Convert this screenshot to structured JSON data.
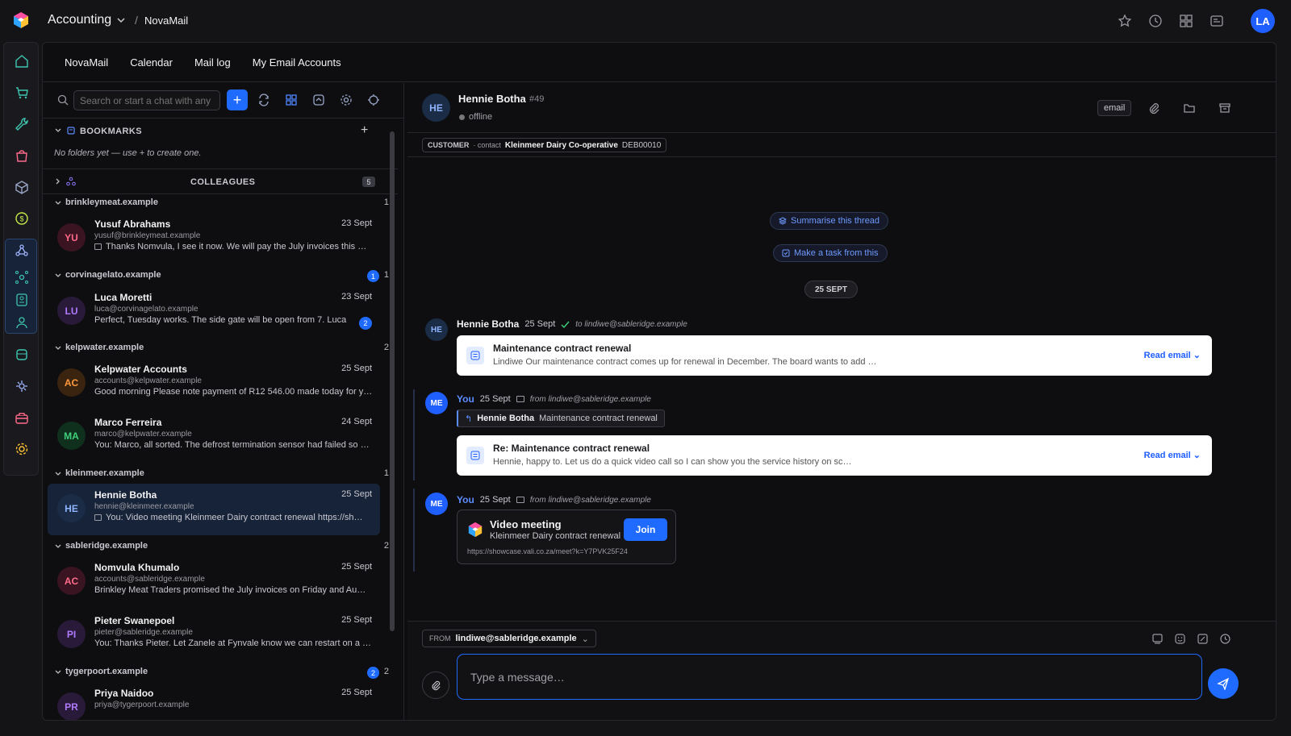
{
  "app": {
    "module": "Accounting",
    "breadcrumb": "NovaMail",
    "user_initials": "LA"
  },
  "tabs": [
    "NovaMail",
    "Calendar",
    "Mail log",
    "My Email Accounts"
  ],
  "search": {
    "placeholder": "Search or start a chat with any"
  },
  "bookmarks": {
    "title": "BOOKMARKS",
    "empty": "No folders yet — use + to create one."
  },
  "colleagues": {
    "title": "COLLEAGUES",
    "count": "5"
  },
  "domains": [
    {
      "name": "brinkleymeat.example",
      "count": "1",
      "badge": ""
    },
    {
      "name": "corvinagelato.example",
      "count": "1",
      "badge": "1"
    },
    {
      "name": "kelpwater.example",
      "count": "2",
      "badge": ""
    },
    {
      "name": "kleinmeer.example",
      "count": "1",
      "badge": ""
    },
    {
      "name": "sableridge.example",
      "count": "2",
      "badge": ""
    },
    {
      "name": "tygerpoort.example",
      "count": "2",
      "badge": "2"
    }
  ],
  "conversations": [
    {
      "initials": "YU",
      "name": "Yusuf Abrahams",
      "date": "23 Sept",
      "email": "yusuf@brinkleymeat.example",
      "preview": "Thanks Nomvula, I see it now. We will pay the July invoices this …",
      "unread": ""
    },
    {
      "initials": "LU",
      "name": "Luca Moretti",
      "date": "23 Sept",
      "email": "luca@corvinagelato.example",
      "preview": "Perfect, Tuesday works. The side gate will be open from 7. Luca",
      "unread": "2"
    },
    {
      "initials": "AC",
      "name": "Kelpwater Accounts",
      "date": "25 Sept",
      "email": "accounts@kelpwater.example",
      "preview": "Good morning Please note payment of R12 546.00 made today for y…",
      "unread": ""
    },
    {
      "initials": "MA",
      "name": "Marco Ferreira",
      "date": "24 Sept",
      "email": "marco@kelpwater.example",
      "preview": "You: Marco, all sorted. The defrost termination sensor had failed so …",
      "unread": ""
    },
    {
      "initials": "HE",
      "name": "Hennie Botha",
      "date": "25 Sept",
      "email": "hennie@kleinmeer.example",
      "preview": "You: Video meeting Kleinmeer Dairy contract renewal https://sh…",
      "unread": ""
    },
    {
      "initials": "AC",
      "name": "Nomvula Khumalo",
      "date": "25 Sept",
      "email": "accounts@sableridge.example",
      "preview": "Brinkley Meat Traders promised the July invoices on Friday and Au…",
      "unread": ""
    },
    {
      "initials": "PI",
      "name": "Pieter Swanepoel",
      "date": "25 Sept",
      "email": "pieter@sableridge.example",
      "preview": "You: Thanks Pieter. Let Zanele at Fynvale know we can restart on a …",
      "unread": ""
    },
    {
      "initials": "PR",
      "name": "Priya Naidoo",
      "date": "25 Sept",
      "email": "priya@tygerpoort.example",
      "preview": "",
      "unread": ""
    }
  ],
  "chat": {
    "initials": "HE",
    "name": "Hennie Botha",
    "id": "#49",
    "status": "offline",
    "channel": "email",
    "customer": {
      "label": "CUSTOMER",
      "sub": "· contact",
      "company": "Kleinmeer Dairy Co-operative",
      "code": "DEB00010"
    },
    "summarise": "Summarise this thread",
    "task": "Make a task from this",
    "date_sep": "25 SEPT",
    "messages": [
      {
        "sender": "Hennie Botha",
        "date": "25 Sept",
        "route": "to lindiwe@sableridge.example",
        "subject": "Maintenance contract renewal",
        "preview": "Lindiwe Our maintenance contract comes up for renewal in December. The board wants to add …",
        "action": "Read email"
      },
      {
        "sender": "You",
        "date": "25 Sept",
        "route": "from lindiwe@sableridge.example",
        "quote_name": "Hennie Botha",
        "quote_text": "Maintenance contract renewal",
        "subject": "Re: Maintenance contract renewal",
        "preview": "Hennie, happy to. Let us do a quick video call so I can show you the service history on sc…",
        "action": "Read email"
      },
      {
        "sender": "You",
        "date": "25 Sept",
        "route": "from lindiwe@sableridge.example",
        "meeting_title": "Video meeting",
        "meeting_sub": "Kleinmeer Dairy contract renewal",
        "meeting_url": "https://showcase.vali.co.za/meet?k=Y7PVK25F24",
        "join": "Join"
      }
    ],
    "me_initials": "ME"
  },
  "composer": {
    "from_label": "FROM",
    "from": "lindiwe@sableridge.example",
    "placeholder": "Type a message…"
  },
  "colors": {
    "accent": "#1f6bff",
    "bg": "#0e0e10"
  }
}
